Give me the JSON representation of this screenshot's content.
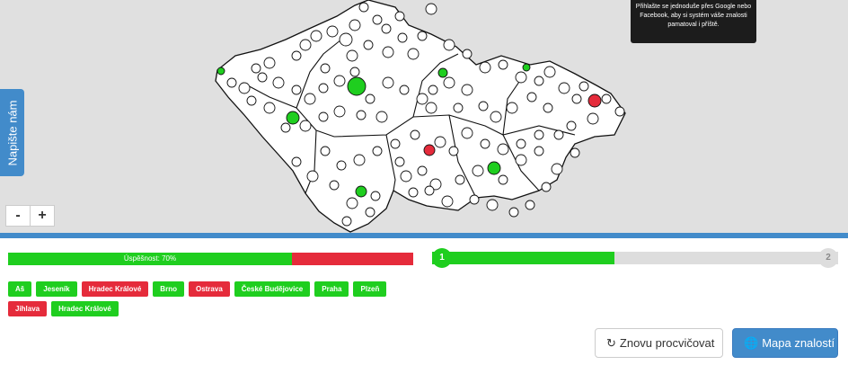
{
  "feedback_tab": {
    "label": "Napište nám"
  },
  "tooltip": {
    "text": "Přihlašte se jednoduše přes Google nebo Facebook, aby si systém váše znalosti pamatoval i příště."
  },
  "zoom": {
    "minus": "-",
    "plus": "+"
  },
  "success": {
    "label": "Úspěšnost: 70%",
    "fraction": 0.7
  },
  "progress": {
    "current_step": "1",
    "total_step": "2",
    "fraction": 0.45
  },
  "answers": [
    {
      "name": "Aš",
      "status": "correct"
    },
    {
      "name": "Jeseník",
      "status": "correct"
    },
    {
      "name": "Hradec Králové",
      "status": "wrong"
    },
    {
      "name": "Brno",
      "status": "correct"
    },
    {
      "name": "Ostrava",
      "status": "wrong"
    },
    {
      "name": "České Budějovice",
      "status": "correct"
    },
    {
      "name": "Praha",
      "status": "correct"
    },
    {
      "name": "Plzeň",
      "status": "correct"
    },
    {
      "name": "Jihlava",
      "status": "wrong"
    },
    {
      "name": "Hradec Králové",
      "status": "correct"
    }
  ],
  "buttons": {
    "again": "Znovu procvičovat",
    "map": "Mapa znalostí"
  },
  "colors": {
    "correct": "#1fce1f",
    "wrong": "#e52b3b",
    "accent": "#428bca"
  }
}
